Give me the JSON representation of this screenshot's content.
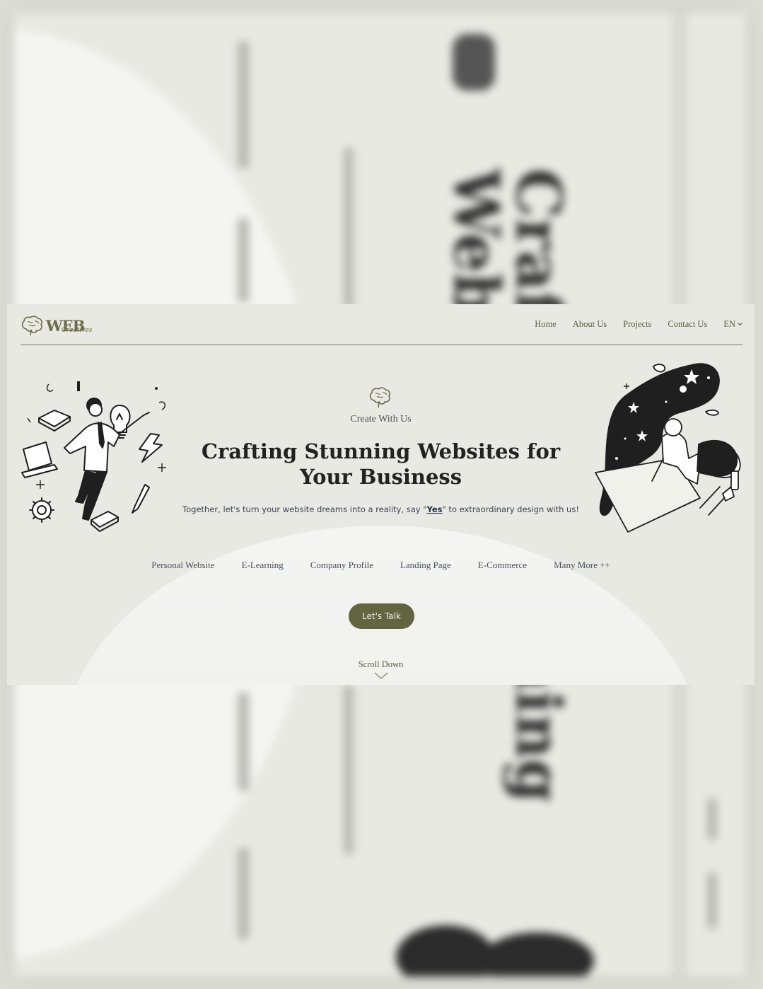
{
  "brand": {
    "logo_text": "WEB",
    "logo_sub": "Creatives",
    "accent": "#62653f"
  },
  "nav": {
    "items": [
      "Home",
      "About Us",
      "Projects",
      "Contact Us"
    ],
    "language": "EN"
  },
  "hero": {
    "eyebrow": "Create With Us",
    "headline_line1": "Crafting Stunning Websites for",
    "headline_line2": "Your Business",
    "subline_before": "Together, let's turn your website dreams into a reality, say \"",
    "subline_emphasis": "Yes",
    "subline_after": "\" to extraordinary design with us!",
    "services": [
      "Personal Website",
      "E-Learning",
      "Company Profile",
      "Landing Page",
      "E-Commerce",
      "Many More ++"
    ],
    "cta_label": "Let's Talk",
    "scroll_label": "Scroll Down"
  },
  "icons": {
    "logo": "brain-icon",
    "language_dropdown": "chevron-down-icon",
    "scroll": "chevron-down-icon",
    "left_illustration": "person-with-lightbulb-illustration",
    "right_illustration": "woman-drawing-galaxy-illustration"
  }
}
